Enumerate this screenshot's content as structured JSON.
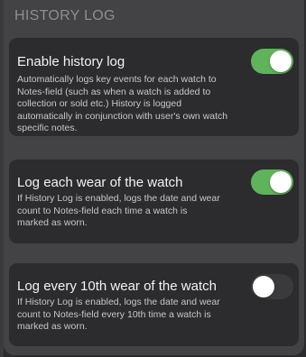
{
  "section": {
    "title": "HISTORY LOG"
  },
  "settings": [
    {
      "title": "Enable history log",
      "lines": [
        "Automatically logs key events for each watch to",
        "Notes-field (such as when a watch is added to",
        "collection or sold etc.)  History is logged",
        "automatically in conjunction with user's own watch",
        "specific notes."
      ],
      "enabled": true
    },
    {
      "title": "Log each wear of the watch",
      "lines": [
        "If History Log is enabled, logs the date and wear",
        "count to Notes-field each time a watch is",
        "marked as worn."
      ],
      "enabled": true
    },
    {
      "title": "Log every 10th wear of the watch",
      "lines": [
        "If History Log is enabled, logs the date and wear",
        "count to Notes-field every 10th time a watch is",
        "marked as worn."
      ],
      "enabled": false
    }
  ],
  "colors": {
    "toggle_on": "#5fb35a",
    "toggle_off": "#3a3a3c",
    "card_background": "#2c2c2e",
    "panel_background": "#434345",
    "header_text": "#8e8e93"
  }
}
